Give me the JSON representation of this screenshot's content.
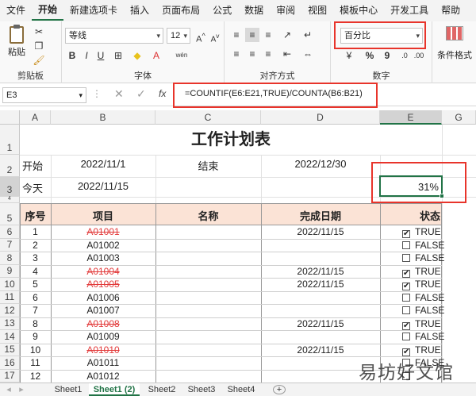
{
  "menu": [
    "文件",
    "开始",
    "新建选项卡",
    "插入",
    "页面布局",
    "公式",
    "数据",
    "审阅",
    "视图",
    "模板中心",
    "开发工具",
    "帮助"
  ],
  "ribbon": {
    "paste_label": "粘贴",
    "clipboard_label": "剪贴板",
    "font_name": "等线",
    "font_size": "12",
    "font_label": "字体",
    "align_label": "对齐方式",
    "number_format": "百分比",
    "number_label": "数字",
    "conditional_format": "条件格式",
    "currency_symbol": "¥",
    "percent_symbol": "%",
    "comma_symbol": "9"
  },
  "formula_bar": {
    "name_box": "E3",
    "fx": "fx",
    "formula": "=COUNTIF(E6:E21,TRUE)/COUNTA(B6:B21)"
  },
  "columns": [
    "A",
    "B",
    "C",
    "D",
    "E",
    "G"
  ],
  "rows": [
    "1",
    "2",
    "3",
    "4",
    "5",
    "6",
    "7",
    "8",
    "9",
    "10",
    "11",
    "12",
    "13",
    "14",
    "15",
    "16",
    "17"
  ],
  "sheet": {
    "title": "工作计划表",
    "start_label": "开始",
    "start_date": "2022/11/1",
    "end_label": "结束",
    "end_date": "2022/12/30",
    "today_label": "今天",
    "today_date": "2022/11/15",
    "percent": "31%",
    "headers": {
      "seq": "序号",
      "item": "项目",
      "name": "名称",
      "done_date": "完成日期",
      "status": "状态"
    },
    "tasks": [
      {
        "seq": "1",
        "item": "A01001",
        "done": "2022/11/15",
        "checked": "✔",
        "status": "TRUE"
      },
      {
        "seq": "2",
        "item": "A01002",
        "done": "",
        "checked": "",
        "status": "FALSE"
      },
      {
        "seq": "3",
        "item": "A01003",
        "done": "",
        "checked": "",
        "status": "FALSE"
      },
      {
        "seq": "4",
        "item": "A01004",
        "done": "2022/11/15",
        "checked": "✔",
        "status": "TRUE"
      },
      {
        "seq": "5",
        "item": "A01005",
        "done": "2022/11/15",
        "checked": "✔",
        "status": "TRUE"
      },
      {
        "seq": "6",
        "item": "A01006",
        "done": "",
        "checked": "",
        "status": "FALSE"
      },
      {
        "seq": "7",
        "item": "A01007",
        "done": "",
        "checked": "",
        "status": "FALSE"
      },
      {
        "seq": "8",
        "item": "A01008",
        "done": "2022/11/15",
        "checked": "✔",
        "status": "TRUE"
      },
      {
        "seq": "9",
        "item": "A01009",
        "done": "",
        "checked": "",
        "status": "FALSE"
      },
      {
        "seq": "10",
        "item": "A01010",
        "done": "2022/11/15",
        "checked": "✔",
        "status": "TRUE"
      },
      {
        "seq": "11",
        "item": "A01011",
        "done": "",
        "checked": "",
        "status": "FALSE"
      },
      {
        "seq": "12",
        "item": "A01012",
        "done": "",
        "checked": "",
        "status": ""
      }
    ]
  },
  "tabs": [
    "Sheet1",
    "Sheet1 (2)",
    "Sheet2",
    "Sheet3",
    "Sheet4"
  ],
  "add_sheet": "+",
  "watermark": "易坊好文馆"
}
